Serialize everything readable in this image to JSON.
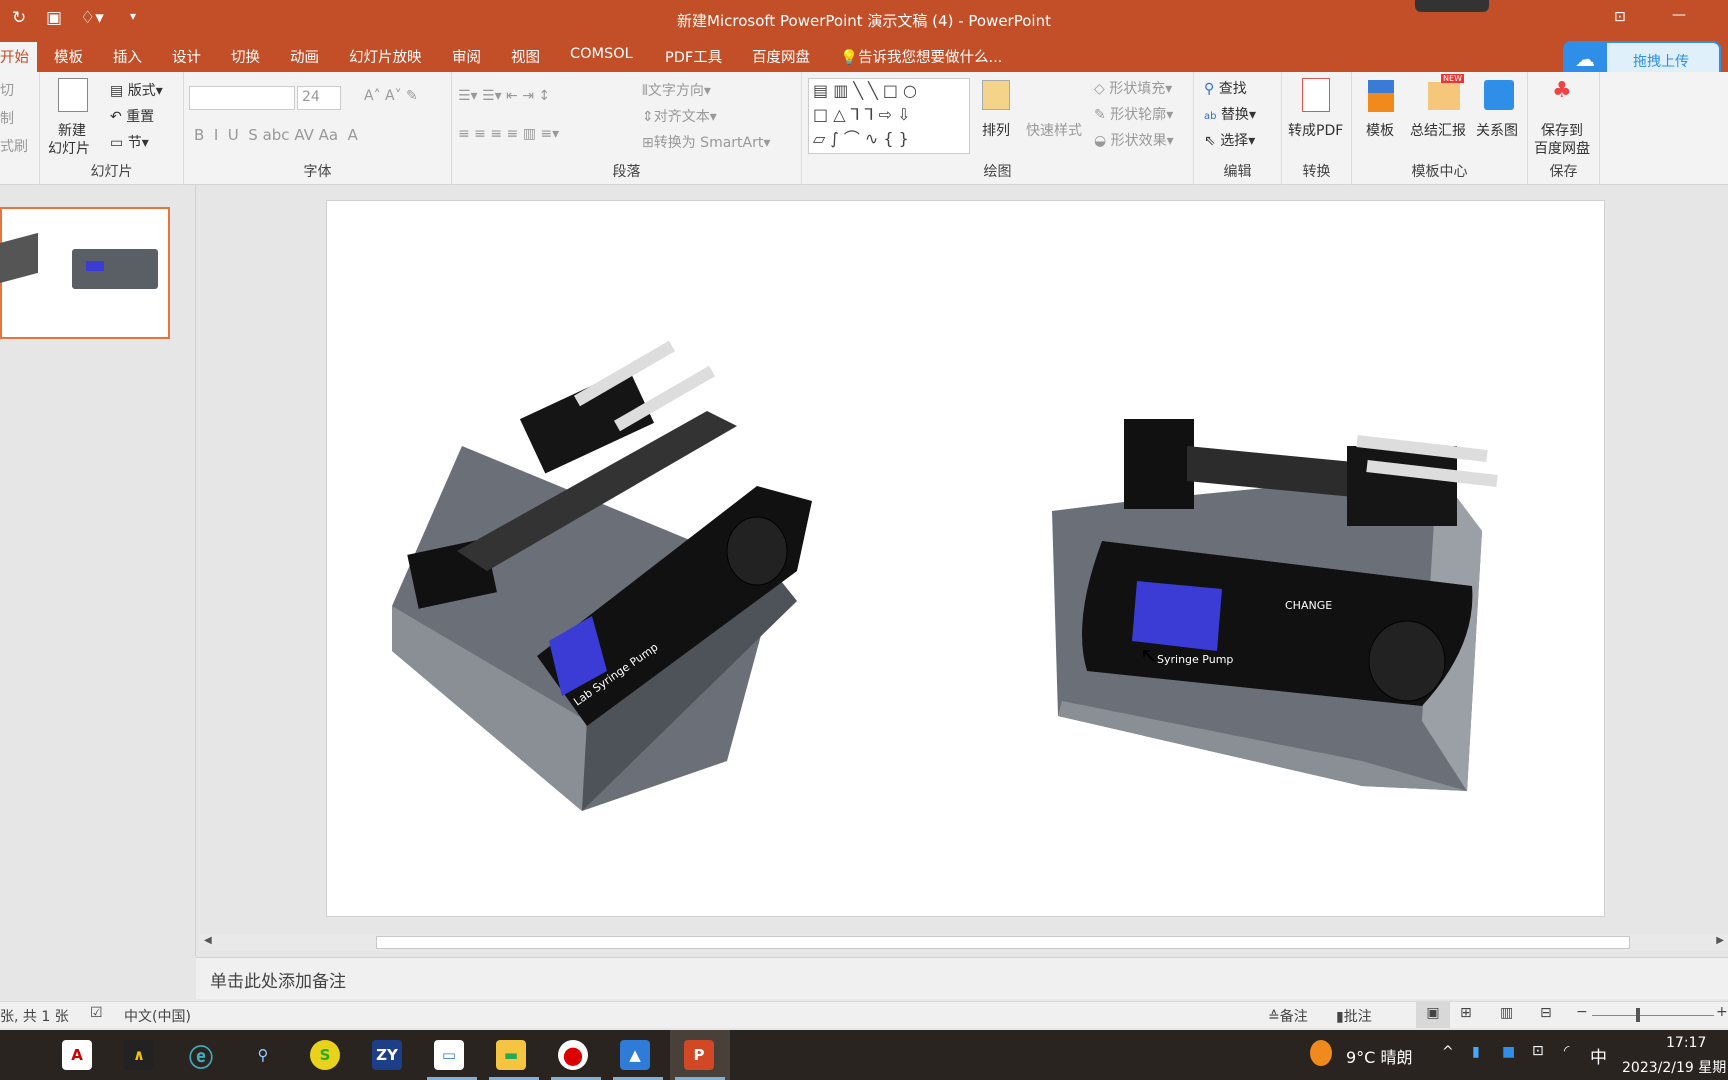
{
  "window": {
    "title": "新建Microsoft PowerPoint 演示文稿 (4) - PowerPoint"
  },
  "tabs": [
    "开始",
    "模板",
    "插入",
    "设计",
    "切换",
    "动画",
    "幻灯片放映",
    "审阅",
    "视图",
    "COMSOL",
    "PDF工具",
    "百度网盘"
  ],
  "tell_me": "告诉我您想要做什么...",
  "baidu_upload": "拖拽上传",
  "ribbon": {
    "clipboard": {
      "cut": "切",
      "copy": "制",
      "format": "式刷"
    },
    "slides": {
      "new_slide_1": "新建",
      "new_slide_2": "幻灯片",
      "layout": "版式",
      "reset": "重置",
      "section": "节",
      "label": "幻灯片"
    },
    "font": {
      "size": "24",
      "label": "字体"
    },
    "paragraph": {
      "text_direction": "文字方向",
      "align_text": "对齐文本",
      "smartart": "转换为 SmartArt",
      "label": "段落"
    },
    "drawing": {
      "arrange": "排列",
      "quick_styles": "快速样式",
      "shape_fill": "形状填充",
      "shape_outline": "形状轮廓",
      "shape_effects": "形状效果",
      "label": "绘图"
    },
    "editing": {
      "find": "查找",
      "replace": "替换",
      "select": "选择",
      "label": "编辑"
    },
    "convert": {
      "to_pdf": "转成PDF",
      "label": "转换"
    },
    "template": {
      "template": "模板",
      "summary": "总结汇报",
      "relation": "关系图",
      "badge": "NEW",
      "label": "模板中心"
    },
    "save": {
      "save_1": "保存到",
      "save_2": "百度网盘",
      "label": "保存"
    }
  },
  "slide": {
    "pump1_label": "Lab Syringe Pump",
    "pump2_label": "Syringe Pump",
    "change": "CHANGE"
  },
  "notes_placeholder": "单击此处添加备注",
  "status": {
    "slide_count": "张, 共 1 张",
    "language": "中文(中国)",
    "notes": "备注",
    "comments": "批注"
  },
  "taskbar": {
    "weather": "9°C 晴朗",
    "ime": "中",
    "time": "17:17",
    "date": "2023/2/19 星期"
  },
  "colors": {
    "accent": "#c24f28",
    "screen": "#3b3bd6"
  }
}
